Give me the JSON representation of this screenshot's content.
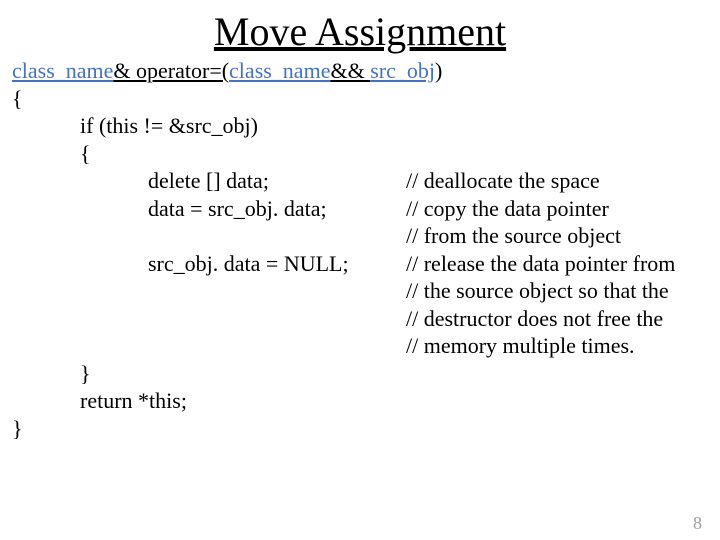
{
  "title": "Move Assignment",
  "sig": {
    "p1": "class_name",
    "p2": "& operator=(",
    "p3": "class_name",
    "p4": "&& ",
    "p5": "src_obj",
    "p6": ")"
  },
  "br_open_outer": "{",
  "if_line": "if (this != &src_obj)",
  "br_open_inner": "{",
  "rows": {
    "r1": {
      "code": "delete [] data;",
      "cmt": "// deallocate the space"
    },
    "r2": {
      "code": "data = src_obj. data;",
      "cmt": "// copy the data pointer"
    },
    "r3": {
      "code": "",
      "cmt": "// from the source object"
    },
    "r4": {
      "code": "src_obj. data = NULL;",
      "cmt": "// release the data pointer from"
    },
    "r5": {
      "code": "",
      "cmt": "// the source object so that the"
    },
    "r6": {
      "code": "",
      "cmt": "// destructor does not free the"
    },
    "r7": {
      "code": "",
      "cmt": "// memory multiple times."
    }
  },
  "br_close_inner": "}",
  "return_line": "return *this;",
  "br_close_outer": "}",
  "page_number": "8"
}
